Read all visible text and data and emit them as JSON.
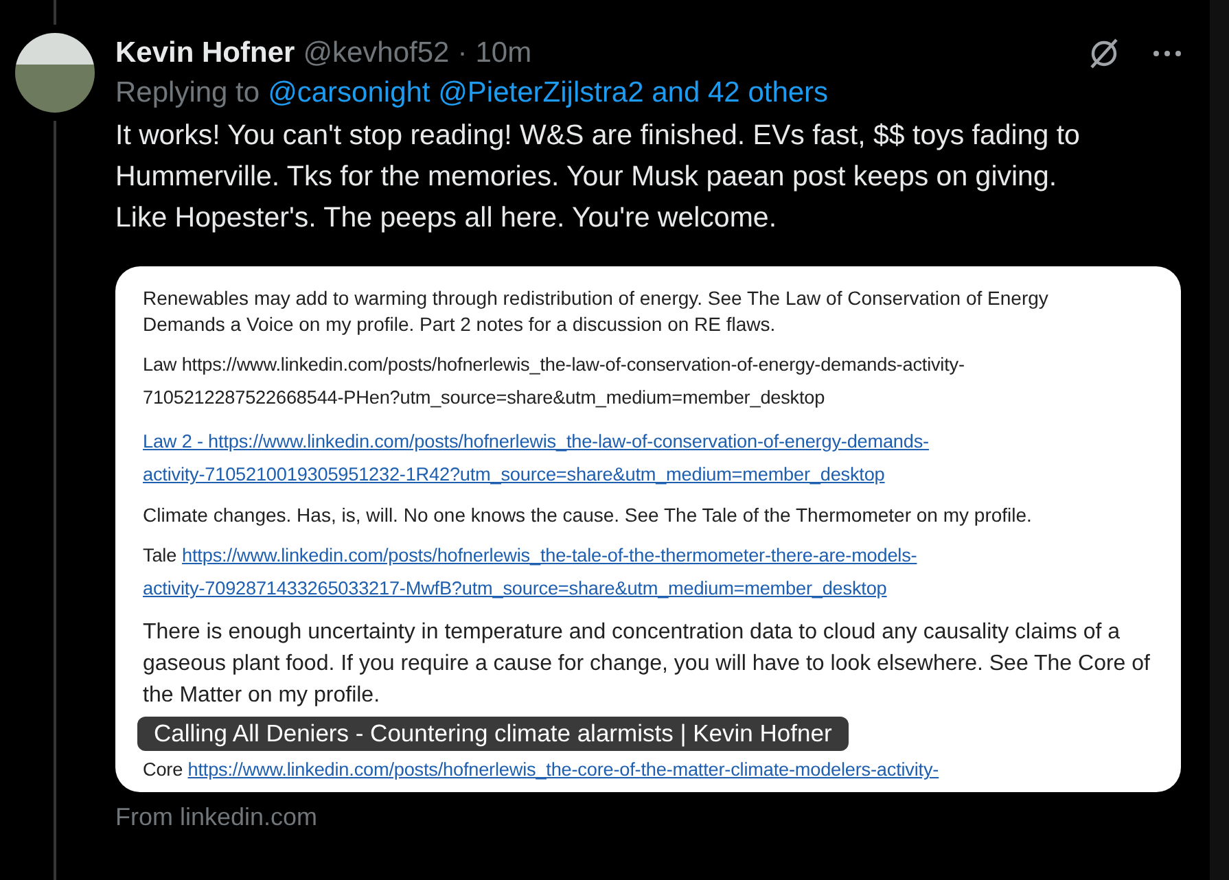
{
  "post": {
    "name": "Kevin Hofner",
    "handle": "@kevhof52",
    "separator": "·",
    "time": "10m",
    "replying_label": "Replying to",
    "replying_to": "@carsonight @PieterZijlstra2 and 42 others",
    "text": "It works! You can't stop reading! W&S are finished. EVs fast, $$ toys fading to Hummerville. Tks for the memories. Your Musk paean post keeps on giving. Like Hopester's. The peeps all here. You're welcome."
  },
  "card": {
    "paragraphs": [
      {
        "kind": "plain",
        "text": "Renewables may add to warming through redistribution of energy.  See The Law of Conservation of Energy Demands a Voice on my profile. Part 2 notes for a discussion on RE flaws."
      },
      {
        "kind": "text_lines",
        "lines": [
          "Law https://www.linkedin.com/posts/hofnerlewis_the-law-of-conservation-of-energy-demands-activity-",
          "7105212287522668544-PHen?utm_source=share&utm_medium=member_desktop"
        ]
      },
      {
        "kind": "link_lines",
        "lines": [
          "Law 2 -  https://www.linkedin.com/posts/hofnerlewis_the-law-of-conservation-of-energy-demands-",
          "activity-7105210019305951232-1R42?utm_source=share&utm_medium=member_desktop"
        ]
      },
      {
        "kind": "plain",
        "text": "Climate changes.  Has, is, will.  No one knows the cause. See The Tale of the Thermometer on my profile."
      },
      {
        "kind": "prefixed_lines",
        "prefix": "Tale",
        "lines": [
          "https://www.linkedin.com/posts/hofnerlewis_the-tale-of-the-thermometer-there-are-models-",
          "activity-7092871433265033217-MwfB?utm_source=share&utm_medium=member_desktop"
        ]
      },
      {
        "kind": "large",
        "text": "There is enough uncertainty in temperature and concentration data to cloud any causality claims of a gaseous plant food. If you require a cause for change, you will have to look elsewhere. See The Core of the Matter on my profile."
      }
    ],
    "title": "Calling All Deniers - Countering climate alarmists | Kevin Hofner",
    "after_title": {
      "prefix": "Core",
      "link": "https://www.linkedin.com/posts/hofnerlewis_the-core-of-the-matter-climate-modelers-activity-"
    },
    "source": "From linkedin.com"
  }
}
